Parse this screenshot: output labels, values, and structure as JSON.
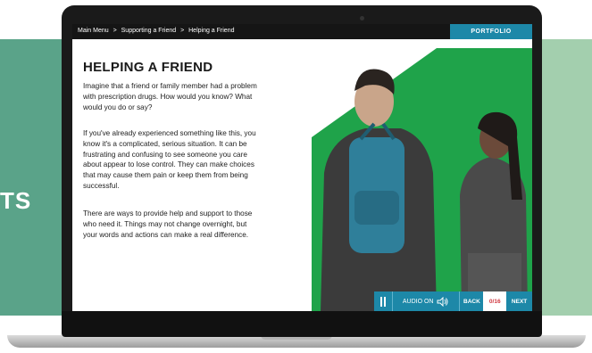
{
  "background": {
    "left_text": "TS"
  },
  "header": {
    "breadcrumb": [
      "Main Menu",
      ">",
      "Supporting a Friend",
      ">",
      "Helping a Friend"
    ],
    "portfolio_label": "PORTFOLIO"
  },
  "content": {
    "title": "HELPING A FRIEND",
    "paragraphs": [
      "Imagine that a friend or family member had a problem with prescription drugs. How would you know? What would you do or say?",
      "If you've already experienced something like this, you know it's a complicated, serious situation. It can be frustrating and confusing to see someone you care about appear to lose control. They can make choices that may cause them pain or keep them from being successful.",
      "There are ways to provide help and support to those who need it. Things may not change overnight, but your words and actions can make a real difference."
    ]
  },
  "controls": {
    "audio_label": "AUDIO ON",
    "back_label": "BACK",
    "progress": "0/16",
    "next_label": "NEXT"
  },
  "colors": {
    "accent": "#1d88a8",
    "green": "#1fa34a",
    "progress_text": "#d0373f"
  },
  "icons": [
    "pause-icon",
    "speaker-icon"
  ]
}
